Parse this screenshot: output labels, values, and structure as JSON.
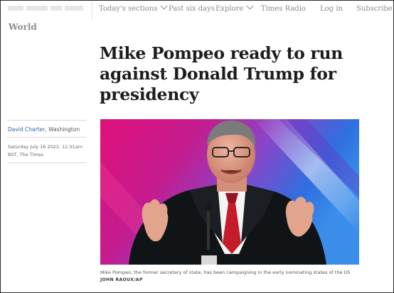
{
  "nav": {
    "todays_sections": "Today's sections",
    "past_six_days": "Past six days",
    "explore": "Explore",
    "times_radio": "Times Radio",
    "log_in": "Log in",
    "subscribe": "Subscribe"
  },
  "section": "World",
  "headline": "Mike Pompeo ready to run against Donald Trump for presidency",
  "byline": {
    "author": "David Charter",
    "location": ", Washington"
  },
  "dateline": "Saturday July 16 2022, 12.01am BST, The Times",
  "photo": {
    "caption": "Mike Pompeo, the former secretary of state, has been campaigning in the early nominating states of the US",
    "credit": "JOHN RAOUX/AP"
  },
  "colors": {
    "link": "#2d6aa6",
    "nav_text": "#8a8a8a",
    "headline": "#1d1d1b"
  }
}
